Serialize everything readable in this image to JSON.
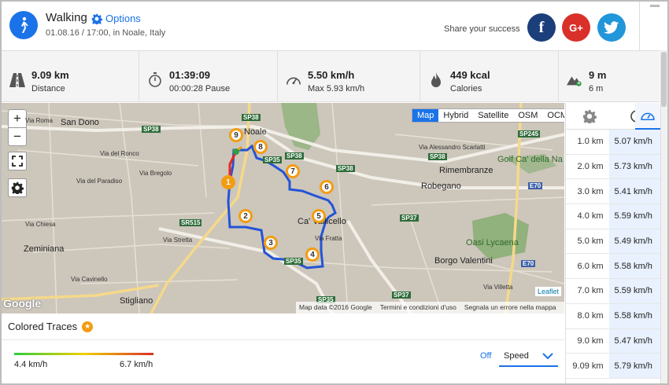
{
  "header": {
    "title": "Walking",
    "options_label": "Options",
    "meta": "01.08.16 / 17:00, in Noale, Italy",
    "share_label": "Share your success",
    "share_facebook": "f",
    "share_google": "G+",
    "colors": {
      "accent": "#1a73e8",
      "facebook": "#1b3f7a",
      "google": "#d9302a",
      "twitter": "#2196d9"
    }
  },
  "stats": {
    "distance": {
      "value": "9.09 km",
      "label": "Distance",
      "icon": "road-icon"
    },
    "duration": {
      "value": "01:39:09",
      "label": "00:00:28 Pause",
      "icon": "stopwatch-icon"
    },
    "speed": {
      "value": "5.50 km/h",
      "label": "Max 5.93 km/h",
      "icon": "speedometer-icon"
    },
    "calories": {
      "value": "449 kcal",
      "label": "Calories",
      "icon": "flame-icon"
    },
    "elevation": {
      "value": "9 m",
      "label": "6 m",
      "icon": "mountain-icon"
    }
  },
  "map": {
    "zoom_in": "+",
    "zoom_out": "−",
    "layers": [
      "Map",
      "Hybrid",
      "Satellite",
      "OSM",
      "OCM"
    ],
    "active_layer": "Map",
    "places": [
      "San Dono",
      "Noale",
      "Via Roma",
      "Via del Ronco",
      "Via Alessandro Scarlatti",
      "Rimembranze",
      "Golf Ca' della Na",
      "Robegano",
      "Ca' Vallicello",
      "Zeminiana",
      "Via Chiesa",
      "Via Stretta",
      "Oasi Lycaena",
      "Borgo Valentini",
      "Stigliano",
      "Via Villetta",
      "Via Fratta",
      "Via Cavinello",
      "Via del Paradiso",
      "Via Bregolo"
    ],
    "roads": [
      "SP38",
      "SP35",
      "SR515",
      "SP245",
      "SP37",
      "E70"
    ],
    "markers": [
      "1",
      "2",
      "3",
      "4",
      "5",
      "6",
      "7",
      "8",
      "9"
    ],
    "google_logo": "Google",
    "attribution": [
      "Map data ©2016 Google",
      "Termini e condizioni d'uso",
      "Segnala un errore nella mappa"
    ],
    "leaflet": "Leaflet"
  },
  "splits": {
    "rows": [
      {
        "km": "1.0 km",
        "speed": "5.07 km/h"
      },
      {
        "km": "2.0 km",
        "speed": "5.73 km/h"
      },
      {
        "km": "3.0 km",
        "speed": "5.41 km/h"
      },
      {
        "km": "4.0 km",
        "speed": "5.59 km/h"
      },
      {
        "km": "5.0 km",
        "speed": "5.49 km/h"
      },
      {
        "km": "6.0 km",
        "speed": "5.58 km/h"
      },
      {
        "km": "7.0 km",
        "speed": "5.59 km/h"
      },
      {
        "km": "8.0 km",
        "speed": "5.58 km/h"
      },
      {
        "km": "9.0 km",
        "speed": "5.47 km/h"
      },
      {
        "km": "9.09 km",
        "speed": "5.79 km/h"
      }
    ]
  },
  "traces": {
    "title": "Colored Traces",
    "min": "4.4 km/h",
    "max": "6.7 km/h",
    "off_label": "Off",
    "selected": "Speed"
  }
}
